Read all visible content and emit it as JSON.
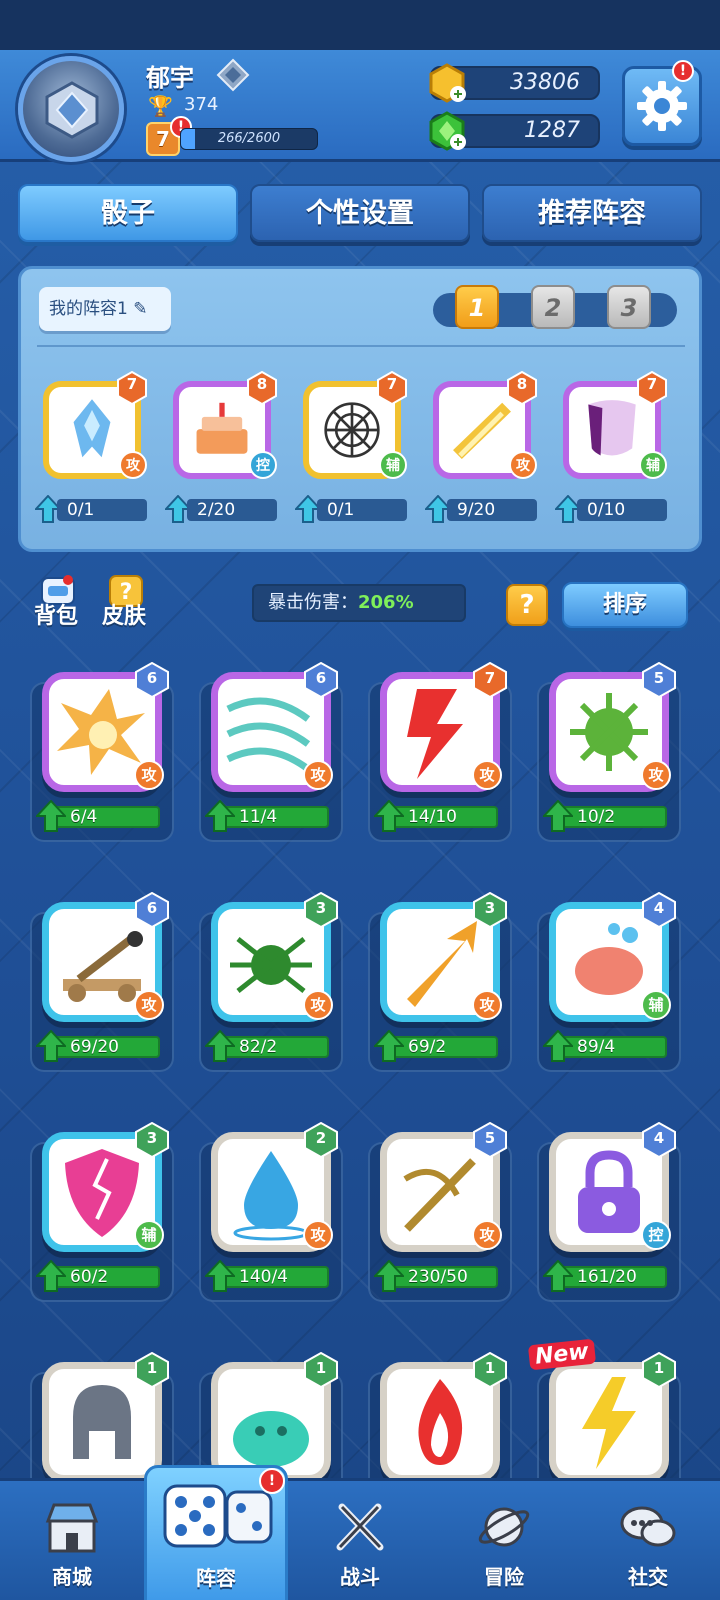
{
  "player": {
    "name": "郁宇",
    "trophies": "374",
    "level": "7",
    "level_alert": "!",
    "xp_text": "266/2600",
    "xp_fraction": 0.102
  },
  "resources": {
    "gold": "33806",
    "gems": "1287"
  },
  "settings_alert": "!",
  "tabs": [
    {
      "label": "骰子",
      "active": true
    },
    {
      "label": "个性设置",
      "active": false
    },
    {
      "label": "推荐阵容",
      "active": false
    }
  ],
  "deck": {
    "name_label": "我的阵容1",
    "slots": [
      "1",
      "2",
      "3"
    ],
    "active_slot": "1",
    "cards": [
      {
        "level": "7",
        "role": "攻",
        "progress": "0/1",
        "icon": "ice-dragon-icon",
        "frame": "gold"
      },
      {
        "level": "8",
        "role": "控",
        "progress": "2/20",
        "icon": "cake-icon",
        "frame": "purple"
      },
      {
        "level": "7",
        "role": "辅",
        "progress": "0/1",
        "icon": "web-icon",
        "frame": "gold"
      },
      {
        "level": "8",
        "role": "攻",
        "progress": "9/20",
        "icon": "golden-blade-icon",
        "frame": "purple"
      },
      {
        "level": "7",
        "role": "辅",
        "progress": "0/10",
        "icon": "mask-icon",
        "frame": "purple"
      }
    ]
  },
  "toolbar": {
    "bag_label": "背包",
    "skin_label": "皮肤",
    "crit_label": "暴击伤害：",
    "crit_value": "206%",
    "help_label": "?",
    "sort_label": "排序"
  },
  "collection": [
    {
      "level": "6",
      "role": "攻",
      "progress": "6/4",
      "icon": "explosion-icon",
      "frame": "purple"
    },
    {
      "level": "6",
      "role": "攻",
      "progress": "11/4",
      "icon": "wind-icon",
      "frame": "purple"
    },
    {
      "level": "7",
      "role": "攻",
      "progress": "14/10",
      "icon": "lightning-icon",
      "frame": "purple"
    },
    {
      "level": "5",
      "role": "攻",
      "progress": "10/2",
      "icon": "virus-icon",
      "frame": "purple"
    },
    {
      "level": "6",
      "role": "攻",
      "progress": "69/20",
      "icon": "catapult-icon",
      "frame": "cyan"
    },
    {
      "level": "3",
      "role": "攻",
      "progress": "82/2",
      "icon": "spider-icon",
      "frame": "cyan"
    },
    {
      "level": "3",
      "role": "攻",
      "progress": "69/2",
      "icon": "arrow-icon",
      "frame": "cyan"
    },
    {
      "level": "4",
      "role": "辅",
      "progress": "89/4",
      "icon": "piggy-bank-icon",
      "frame": "cyan"
    },
    {
      "level": "3",
      "role": "辅",
      "progress": "60/2",
      "icon": "broken-shield-icon",
      "frame": "cyan"
    },
    {
      "level": "2",
      "role": "攻",
      "progress": "140/4",
      "icon": "water-drop-icon",
      "frame": "gray"
    },
    {
      "level": "5",
      "role": "攻",
      "progress": "230/50",
      "icon": "crossbow-icon",
      "frame": "gray"
    },
    {
      "level": "4",
      "role": "控",
      "progress": "161/20",
      "icon": "lock-icon",
      "frame": "gray"
    },
    {
      "level": "1",
      "role": "",
      "progress": "",
      "icon": "helmet-icon",
      "frame": "gray"
    },
    {
      "level": "1",
      "role": "",
      "progress": "",
      "icon": "slime-icon",
      "frame": "gray"
    },
    {
      "level": "1",
      "role": "",
      "progress": "",
      "icon": "fire-icon",
      "frame": "gray"
    },
    {
      "level": "1",
      "role": "",
      "progress": "",
      "icon": "thunder-bolt-icon",
      "frame": "gray",
      "new_tag": "New"
    }
  ],
  "bottom_nav": [
    {
      "label": "商城",
      "icon": "shop-icon",
      "active": false
    },
    {
      "label": "阵容",
      "icon": "dice-icon",
      "active": true,
      "alert": "!"
    },
    {
      "label": "战斗",
      "icon": "crossed-swords-icon",
      "active": false
    },
    {
      "label": "冒险",
      "icon": "planet-icon",
      "active": false
    },
    {
      "label": "社交",
      "icon": "chat-bubbles-icon",
      "active": false
    }
  ],
  "colors": {
    "role_attack": "#ef7a2d",
    "role_control": "#34a5d8",
    "role_support": "#4dbb4b",
    "progress_green": "#23a838",
    "gold_button": "#f19d19"
  }
}
